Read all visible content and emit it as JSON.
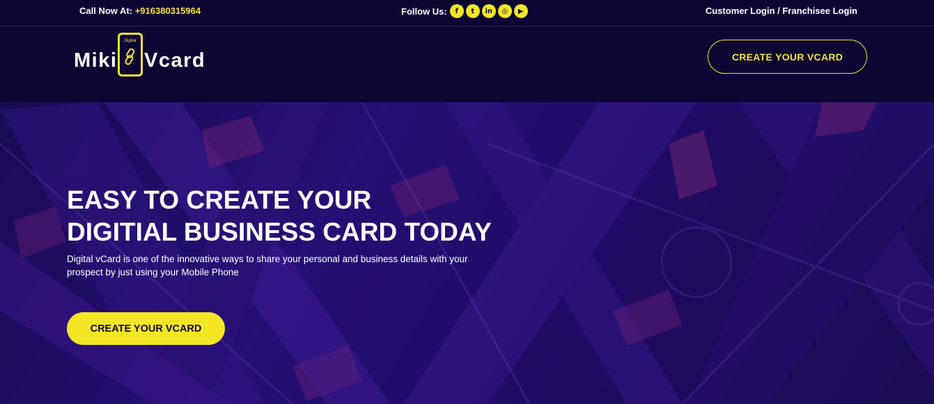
{
  "topbar": {
    "call_label": "Call Now At:",
    "phone": "+916380315964",
    "follow_label": "Follow Us:",
    "social": [
      {
        "icon": "facebook-icon",
        "glyph": "f"
      },
      {
        "icon": "twitter-icon",
        "glyph": "t"
      },
      {
        "icon": "linkedin-icon",
        "glyph": "in"
      },
      {
        "icon": "instagram-icon",
        "glyph": "◎"
      },
      {
        "icon": "youtube-icon",
        "glyph": "▶"
      }
    ],
    "login": "Customer Login / Franchisee Login"
  },
  "header": {
    "logo_left": "Miki",
    "logo_small": "Digital",
    "logo_right": "Vcard",
    "cta": "CREATE YOUR VCARD"
  },
  "hero": {
    "title_line1": "EASY TO CREATE YOUR",
    "title_line2": "DIGITIAL BUSINESS CARD TODAY",
    "description": "Digital vCard is one of the innovative ways to share your personal and business details with your prospect by just using your Mobile Phone",
    "cta": "CREATE YOUR VCARD"
  },
  "colors": {
    "accent": "#f3e625",
    "background": "#0d0633",
    "hero": "#2a1080"
  }
}
